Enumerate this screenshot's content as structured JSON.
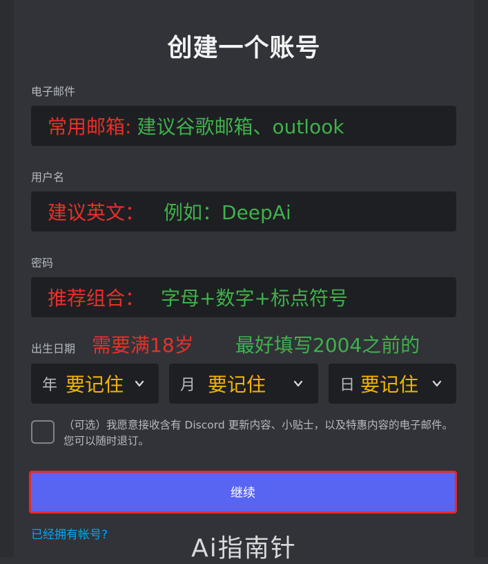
{
  "form": {
    "title": "创建一个账号",
    "email": {
      "label": "电子邮件",
      "note_red": "常用邮箱:",
      "note_green": "建议谷歌邮箱、outlook"
    },
    "username": {
      "label": "用户名",
      "note_red": "建议英文：",
      "note_green": "例如：DeepAi"
    },
    "password": {
      "label": "密码",
      "note_red": "推荐组合：",
      "note_green": "字母+数字+标点符号"
    },
    "dob": {
      "label": "出生日期",
      "note_red": "需要满18岁",
      "note_green": "最好填写2004之前的",
      "year": {
        "placeholder": "年",
        "value": "要记住"
      },
      "month": {
        "placeholder": "月",
        "value": "要记住"
      },
      "day": {
        "placeholder": "日",
        "value": "要记住"
      }
    },
    "consent": "（可选）我愿意接收含有 Discord 更新内容、小贴士，以及特惠内容的电子邮件。您可以随时退订。",
    "continue_label": "继续",
    "login_link": "已经拥有帐号?"
  },
  "watermark": "Ai指南针",
  "colors": {
    "background": "#313338",
    "input": "#1e1f22",
    "button": "#5865f2",
    "button_border_highlight": "#e32b2b",
    "link": "#00a8fc",
    "note_red": "#e8302a",
    "note_green": "#3fb14c",
    "note_yellow": "#f2b400"
  }
}
